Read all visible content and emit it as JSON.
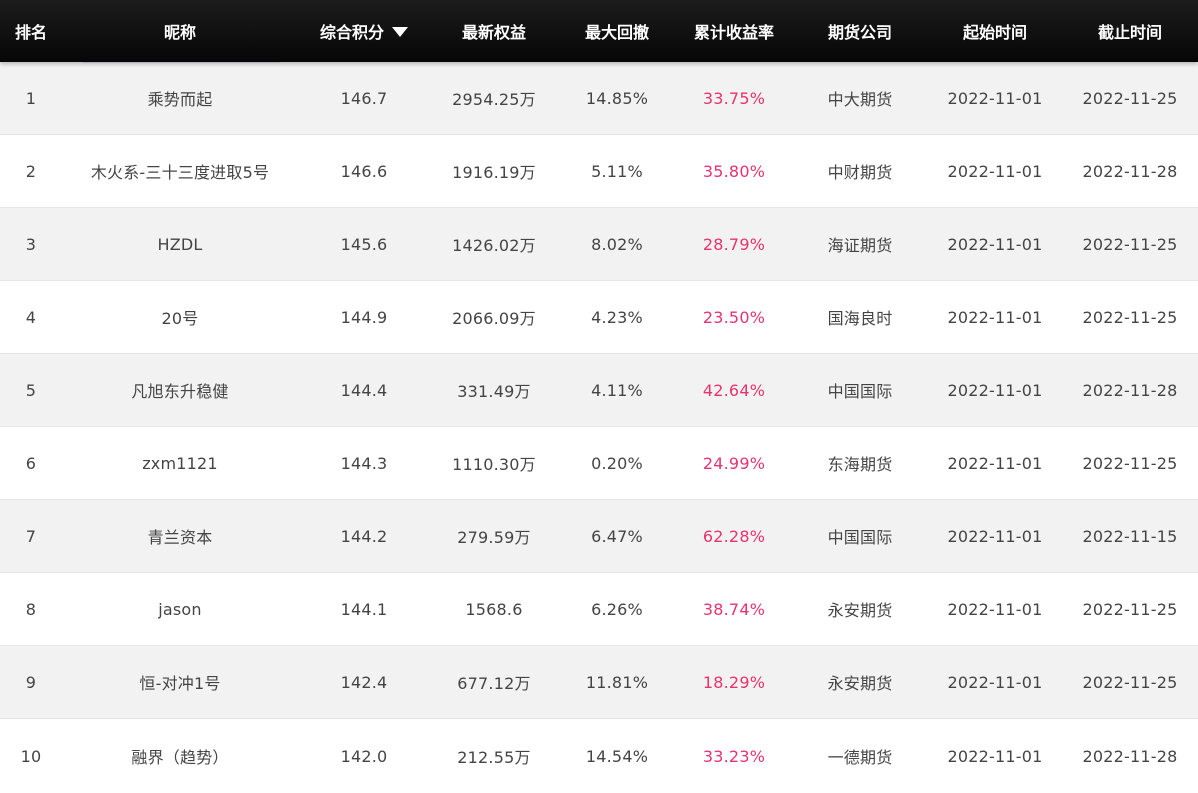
{
  "table": {
    "headers": {
      "rank": "排名",
      "nickname": "昵称",
      "score": "综合积分",
      "equity": "最新权益",
      "max_drawdown": "最大回撤",
      "cumulative_return": "累计收益率",
      "company": "期货公司",
      "start_date": "起始时间",
      "end_date": "截止时间"
    },
    "sort_column": "score",
    "sort_direction": "desc",
    "colors": {
      "header_bg": "#111111",
      "header_text": "#ffffff",
      "row_alt_bg": "#f2f2f2",
      "row_bg": "#ffffff",
      "return_text": "#e8336e"
    },
    "rows": [
      {
        "rank": "1",
        "nickname": "乘势而起",
        "score": "146.7",
        "equity": "2954.25万",
        "max_drawdown": "14.85%",
        "cumulative_return": "33.75%",
        "company": "中大期货",
        "start_date": "2022-11-01",
        "end_date": "2022-11-25"
      },
      {
        "rank": "2",
        "nickname": "木火系-三十三度进取5号",
        "score": "146.6",
        "equity": "1916.19万",
        "max_drawdown": "5.11%",
        "cumulative_return": "35.80%",
        "company": "中财期货",
        "start_date": "2022-11-01",
        "end_date": "2022-11-28"
      },
      {
        "rank": "3",
        "nickname": "HZDL",
        "score": "145.6",
        "equity": "1426.02万",
        "max_drawdown": "8.02%",
        "cumulative_return": "28.79%",
        "company": "海证期货",
        "start_date": "2022-11-01",
        "end_date": "2022-11-25"
      },
      {
        "rank": "4",
        "nickname": "20号",
        "score": "144.9",
        "equity": "2066.09万",
        "max_drawdown": "4.23%",
        "cumulative_return": "23.50%",
        "company": "国海良时",
        "start_date": "2022-11-01",
        "end_date": "2022-11-25"
      },
      {
        "rank": "5",
        "nickname": "凡旭东升稳健",
        "score": "144.4",
        "equity": "331.49万",
        "max_drawdown": "4.11%",
        "cumulative_return": "42.64%",
        "company": "中国国际",
        "start_date": "2022-11-01",
        "end_date": "2022-11-28"
      },
      {
        "rank": "6",
        "nickname": "zxm1121",
        "score": "144.3",
        "equity": "1110.30万",
        "max_drawdown": "0.20%",
        "cumulative_return": "24.99%",
        "company": "东海期货",
        "start_date": "2022-11-01",
        "end_date": "2022-11-25"
      },
      {
        "rank": "7",
        "nickname": "青兰资本",
        "score": "144.2",
        "equity": "279.59万",
        "max_drawdown": "6.47%",
        "cumulative_return": "62.28%",
        "company": "中国国际",
        "start_date": "2022-11-01",
        "end_date": "2022-11-15"
      },
      {
        "rank": "8",
        "nickname": "jason",
        "score": "144.1",
        "equity": "1568.6",
        "max_drawdown": "6.26%",
        "cumulative_return": "38.74%",
        "company": "永安期货",
        "start_date": "2022-11-01",
        "end_date": "2022-11-25"
      },
      {
        "rank": "9",
        "nickname": "恒-对冲1号",
        "score": "142.4",
        "equity": "677.12万",
        "max_drawdown": "11.81%",
        "cumulative_return": "18.29%",
        "company": "永安期货",
        "start_date": "2022-11-01",
        "end_date": "2022-11-25"
      },
      {
        "rank": "10",
        "nickname": "融界（趋势）",
        "score": "142.0",
        "equity": "212.55万",
        "max_drawdown": "14.54%",
        "cumulative_return": "33.23%",
        "company": "一德期货",
        "start_date": "2022-11-01",
        "end_date": "2022-11-28"
      }
    ]
  }
}
